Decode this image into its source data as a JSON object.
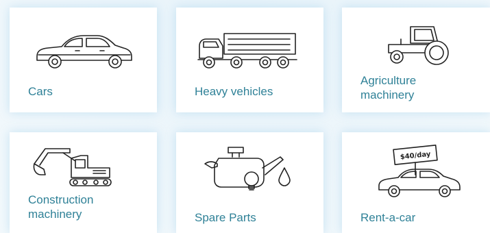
{
  "categories": [
    {
      "id": "cars",
      "label": "Cars",
      "icon": "car-icon"
    },
    {
      "id": "heavy",
      "label": "Heavy vehicles",
      "icon": "truck-icon"
    },
    {
      "id": "agri",
      "label": "Agriculture\nmachinery",
      "icon": "tractor-icon"
    },
    {
      "id": "constr",
      "label": "Construction\nmachinery",
      "icon": "excavator-icon"
    },
    {
      "id": "spare",
      "label": "Spare Parts",
      "icon": "oil-can-icon"
    },
    {
      "id": "rent",
      "label": "Rent-a-car",
      "icon": "rental-car-sign-icon"
    }
  ],
  "rent_sign_text": "$40/day",
  "colors": {
    "label": "#2f8197",
    "tile_background": "#ffffff",
    "page_background": "#eef6fb",
    "icon_stroke": "#222222"
  }
}
